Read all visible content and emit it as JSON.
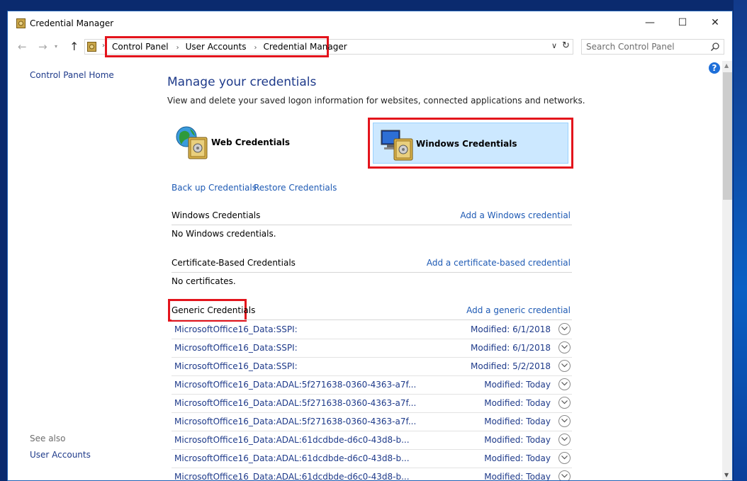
{
  "window": {
    "title": "Credential Manager",
    "controls": {
      "minimize": "—",
      "maximize": "☐",
      "close": "✕"
    }
  },
  "addressbar": {
    "breadcrumbs": [
      "Control Panel",
      "User Accounts",
      "Credential Manager"
    ],
    "search_placeholder": "Search Control Panel"
  },
  "left_pane": {
    "home_link": "Control Panel Home",
    "see_also_label": "See also",
    "see_also_link": "User Accounts"
  },
  "help_icon_label": "?",
  "main": {
    "title": "Manage your credentials",
    "description": "View and delete your saved logon information for websites, connected applications and networks.",
    "tiles": {
      "web": "Web Credentials",
      "windows": "Windows Credentials"
    },
    "backup_link": "Back up Credentials",
    "restore_link": "Restore Credentials",
    "sections": {
      "windows": {
        "title": "Windows Credentials",
        "action": "Add a Windows credential",
        "empty": "No Windows credentials."
      },
      "certificate": {
        "title": "Certificate-Based Credentials",
        "action": "Add a certificate-based credential",
        "empty": "No certificates."
      },
      "generic": {
        "title": "Generic Credentials",
        "action": "Add a generic credential"
      }
    },
    "generic_items": [
      {
        "name": "MicrosoftOffice16_Data:SSPI:",
        "modified": "Modified:  6/1/2018"
      },
      {
        "name": "MicrosoftOffice16_Data:SSPI:",
        "modified": "Modified:  6/1/2018"
      },
      {
        "name": "MicrosoftOffice16_Data:SSPI:",
        "modified": "Modified:  5/2/2018"
      },
      {
        "name": "MicrosoftOffice16_Data:ADAL:5f271638-0360-4363-a7f...",
        "modified": "Modified:  Today"
      },
      {
        "name": "MicrosoftOffice16_Data:ADAL:5f271638-0360-4363-a7f...",
        "modified": "Modified:  Today"
      },
      {
        "name": "MicrosoftOffice16_Data:ADAL:5f271638-0360-4363-a7f...",
        "modified": "Modified:  Today"
      },
      {
        "name": "MicrosoftOffice16_Data:ADAL:61dcdbde-d6c0-43d8-b...",
        "modified": "Modified:  Today"
      },
      {
        "name": "MicrosoftOffice16_Data:ADAL:61dcdbde-d6c0-43d8-b...",
        "modified": "Modified:  Today"
      },
      {
        "name": "MicrosoftOffice16_Data:ADAL:61dcdbde-d6c0-43d8-b...",
        "modified": "Modified:  Today"
      }
    ]
  },
  "colors": {
    "link": "#1e5ab4",
    "heading": "#1e3a8a",
    "highlight_border": "#e3141c",
    "tile_selected": "#cce8ff"
  },
  "icons": [
    "credential-manager-icon",
    "back-arrow-icon",
    "forward-arrow-icon",
    "up-arrow-icon",
    "search-icon",
    "refresh-icon",
    "help-icon",
    "globe-vault-icon",
    "monitor-vault-icon",
    "expand-chevron-icon"
  ]
}
